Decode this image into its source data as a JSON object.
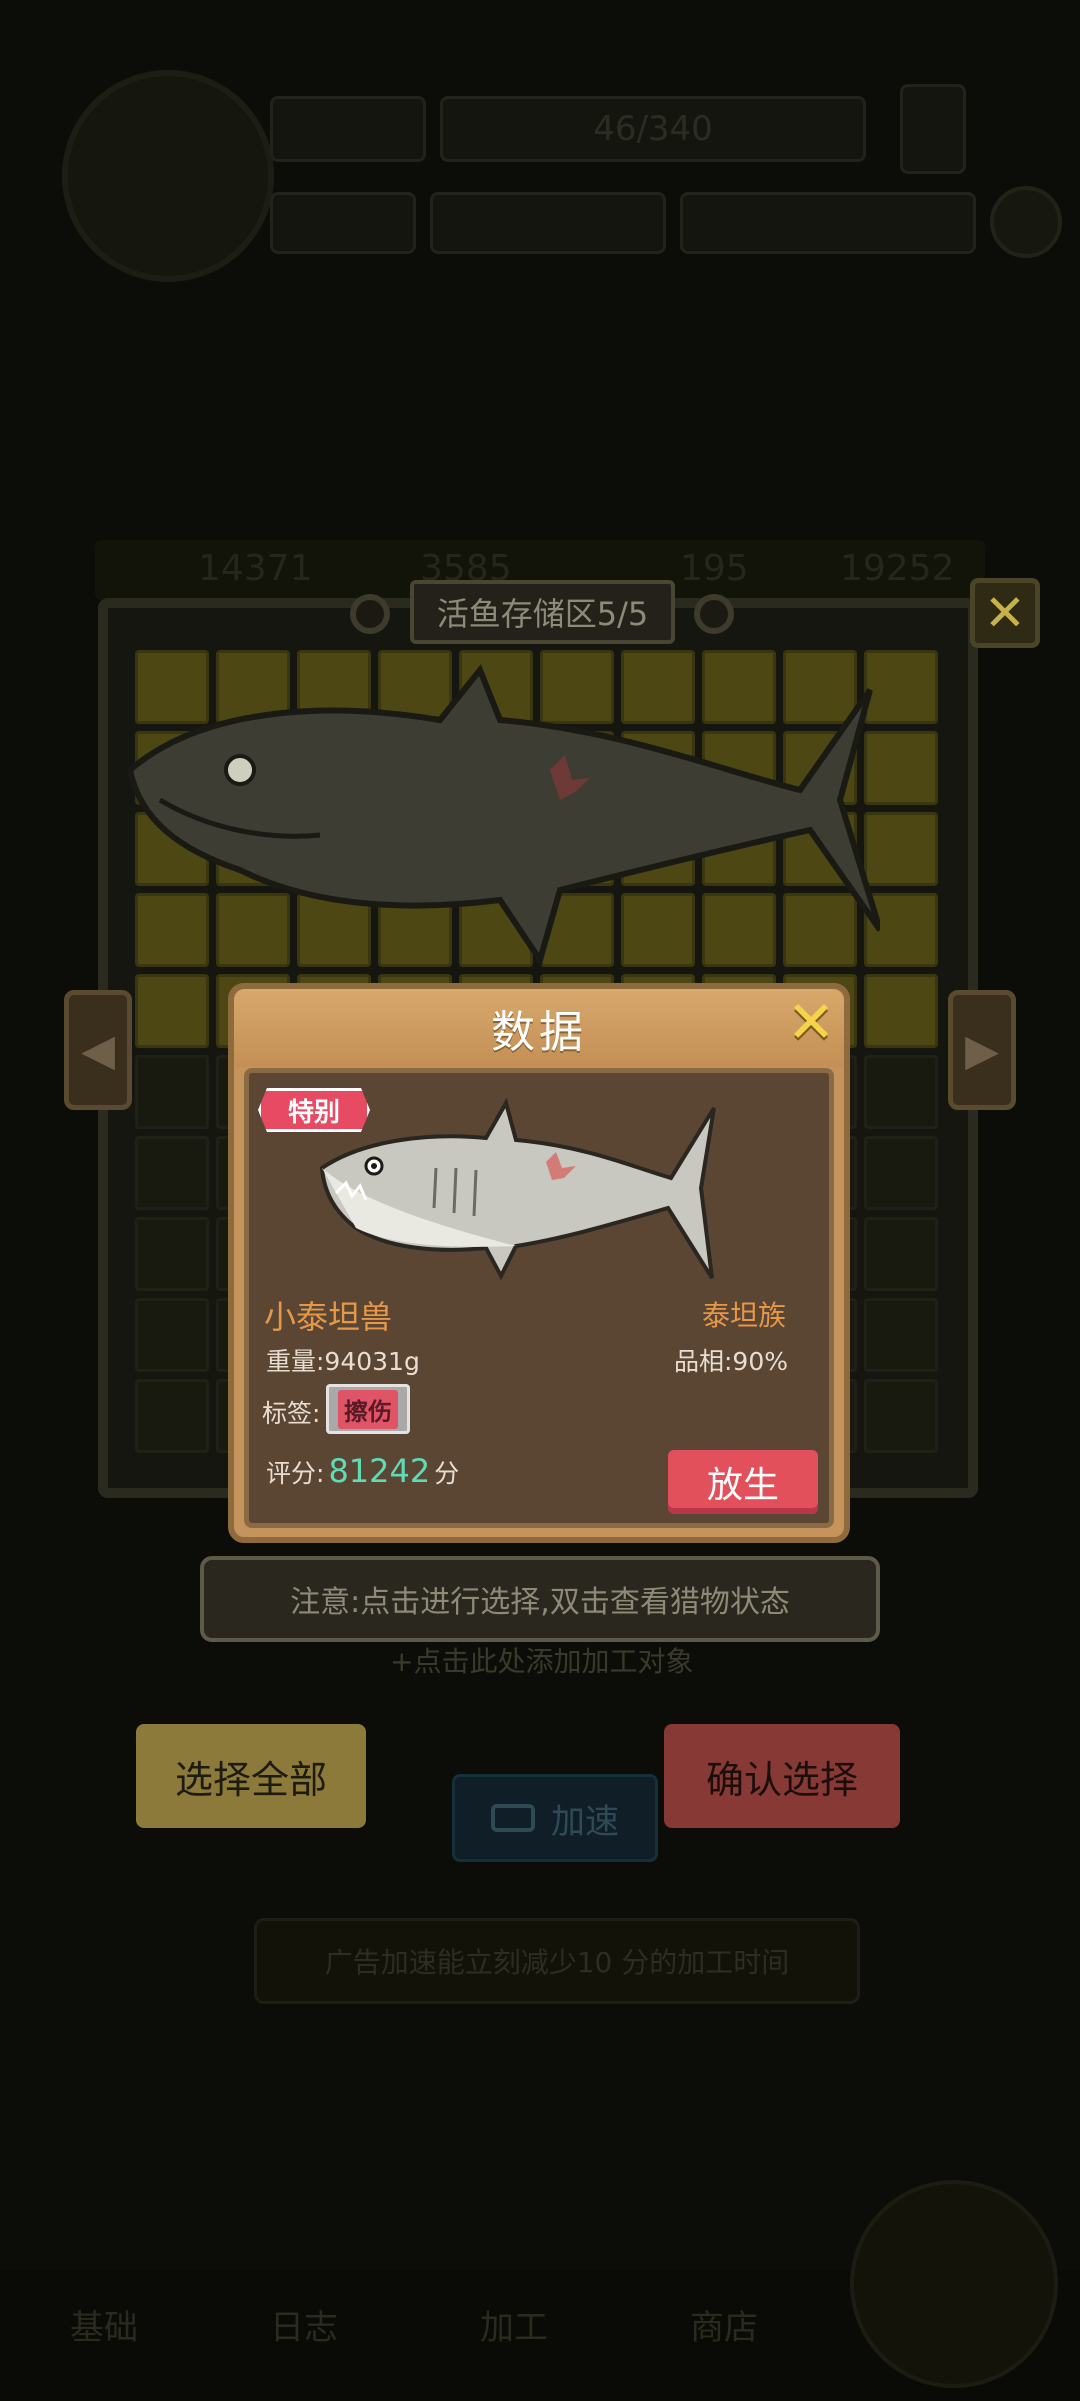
{
  "background": {
    "top_counter": "46/340",
    "resources": [
      "14371",
      "3585",
      "195",
      "19252"
    ],
    "add_hint": "+点击此处添加加工对象",
    "speed_label": "加速",
    "ad_hint": "广告加速能立刻减少10 分的加工时间",
    "bottom_nav": [
      "基础",
      "日志",
      "加工",
      "商店"
    ]
  },
  "storage": {
    "title": "活鱼存储区5/5"
  },
  "modal": {
    "title": "数据",
    "special_tag": "特别",
    "fish_name": "小泰坦兽",
    "family": "泰坦族",
    "weight": "重量:94031g",
    "quality": "品相:90%",
    "label_prefix": "标签:",
    "label_value": "擦伤",
    "score_prefix": "评分:",
    "score_value": "81242",
    "score_unit": "分",
    "release_button": "放生"
  },
  "notice": "注意:点击进行选择,双击查看猎物状态",
  "buttons": {
    "select_all": "选择全部",
    "confirm": "确认选择"
  },
  "icons": {
    "close": "close-icon",
    "arrow_left": "arrow-left-icon",
    "arrow_right": "arrow-right-icon",
    "video": "video-icon"
  },
  "colors": {
    "score": "#5fdcb6",
    "special_tag": "#e64b63",
    "release": "#e2505c",
    "name": "#e5974a"
  }
}
